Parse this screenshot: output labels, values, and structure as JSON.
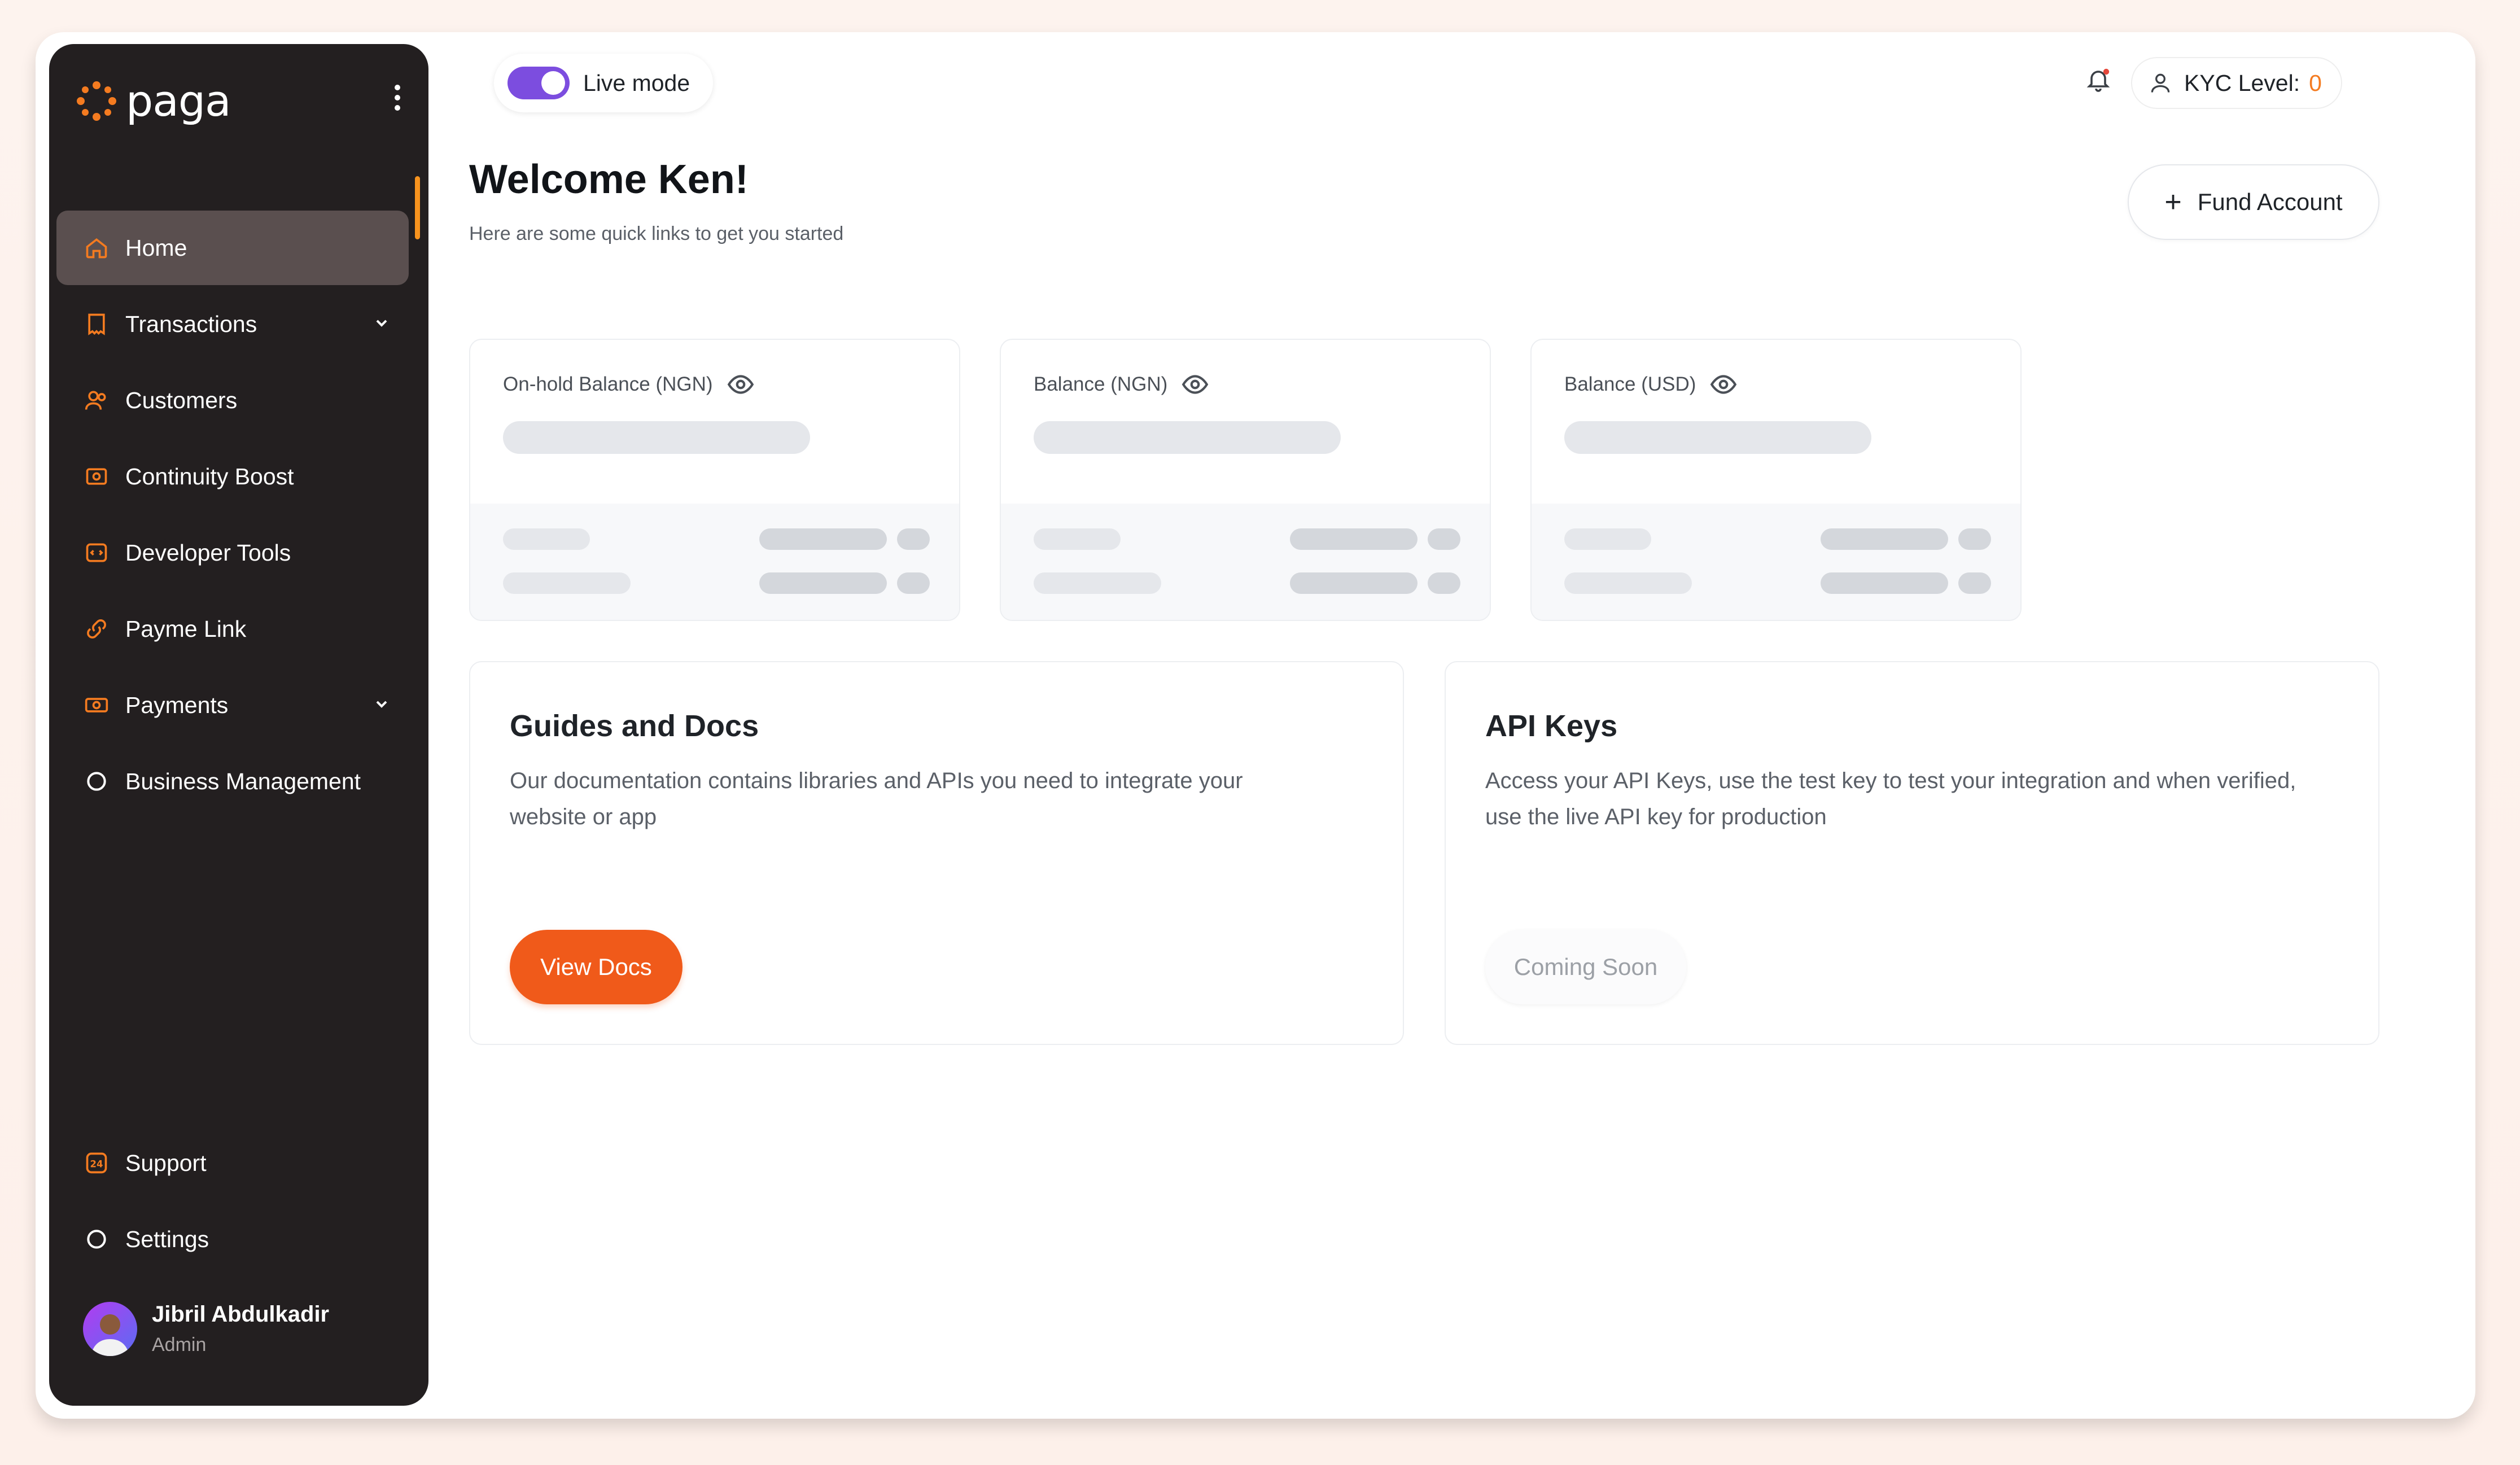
{
  "brand": {
    "name": "paga",
    "accent": "#f47b20",
    "sidebar_bg": "#231f20"
  },
  "sidebar": {
    "items": [
      {
        "label": "Home",
        "icon": "home-icon",
        "active": true
      },
      {
        "label": "Transactions",
        "icon": "receipt-icon",
        "expandable": true
      },
      {
        "label": "Customers",
        "icon": "users-icon"
      },
      {
        "label": "Continuity Boost",
        "icon": "boost-icon"
      },
      {
        "label": "Developer Tools",
        "icon": "code-icon"
      },
      {
        "label": "Payme Link",
        "icon": "link-icon"
      },
      {
        "label": "Payments",
        "icon": "money-icon",
        "expandable": true
      },
      {
        "label": "Business Management",
        "icon": "circle-icon"
      }
    ],
    "bottom_items": [
      {
        "label": "Support",
        "icon": "support-24-icon"
      },
      {
        "label": "Settings",
        "icon": "circle-icon"
      }
    ],
    "user": {
      "name": "Jibril Abdulkadir",
      "role": "Admin"
    }
  },
  "header": {
    "mode_label": "Live mode",
    "kyc_label": "KYC Level:",
    "kyc_value": "0"
  },
  "main": {
    "title": "Welcome Ken!",
    "subtitle": "Here are some quick links to get you started",
    "fund_button": "Fund Account",
    "balances": [
      {
        "label": "On-hold Balance (NGN)"
      },
      {
        "label": "Balance (NGN)"
      },
      {
        "label": "Balance (USD)"
      }
    ],
    "guides": {
      "title": "Guides and Docs",
      "line1": "Our documentation contains libraries and APIs you need to integrate your",
      "line2": "website or app",
      "button": "View Docs"
    },
    "api": {
      "title": "API Keys",
      "line1": "Access your API Keys, use the test key to test your integration and when verified,",
      "line2": "use the live API key for production",
      "button": "Coming Soon"
    }
  }
}
